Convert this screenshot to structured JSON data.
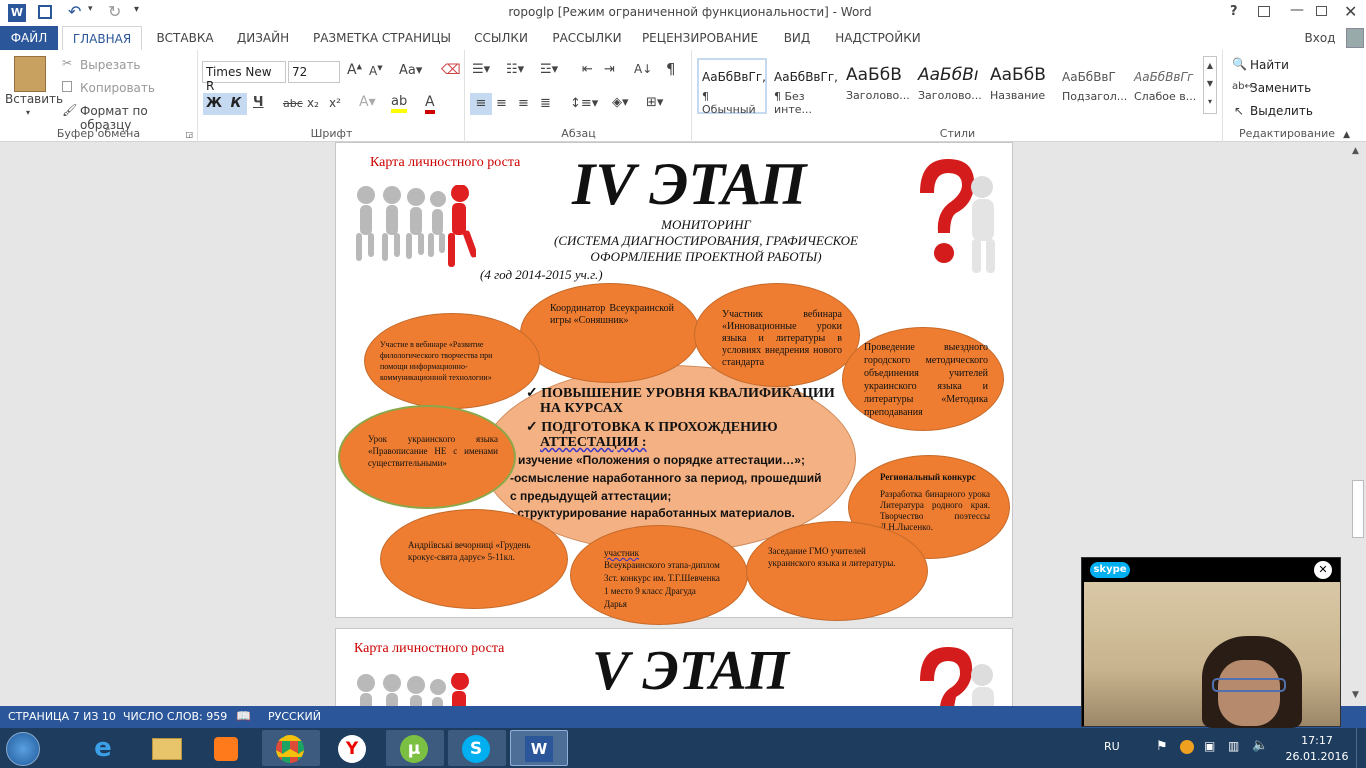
{
  "window": {
    "title": "ropoglp [Режим ограниченной функциональности] - Word",
    "help": "?",
    "login": "Вход"
  },
  "tabs": [
    "ФАЙЛ",
    "ГЛАВНАЯ",
    "ВСТАВКА",
    "ДИЗАЙН",
    "РАЗМЕТКА СТРАНИЦЫ",
    "ССЫЛКИ",
    "РАССЫЛКИ",
    "РЕЦЕНЗИРОВАНИЕ",
    "ВИД",
    "НАДСТРОЙКИ"
  ],
  "clipboard": {
    "paste": "Вставить",
    "cut": "Вырезать",
    "copy": "Копировать",
    "format": "Формат по образцу",
    "label": "Буфер обмена"
  },
  "font": {
    "name": "Times New R",
    "size": "72",
    "label": "Шрифт",
    "bold": "Ж",
    "italic": "К",
    "underline": "Ч",
    "strike": "abc",
    "sub": "x₂",
    "sup": "x²"
  },
  "paragraph": {
    "label": "Абзац"
  },
  "styles": {
    "label": "Стили",
    "items": [
      {
        "sample": "АаБбВвГг,",
        "name": "¶ Обычный"
      },
      {
        "sample": "АаБбВвГг,",
        "name": "¶ Без инте..."
      },
      {
        "sample": "АаБбВ",
        "name": "Заголово..."
      },
      {
        "sample": "АаБбВı",
        "name": "Заголово..."
      },
      {
        "sample": "АаБбВ",
        "name": "Название"
      },
      {
        "sample": "АаБбВвГ",
        "name": "Подзагол..."
      },
      {
        "sample": "АаБбВвГг",
        "name": "Слабое в..."
      }
    ]
  },
  "editing": {
    "find": "Найти",
    "replace": "Заменить",
    "select": "Выделить",
    "label": "Редактирование"
  },
  "page1": {
    "card": "Карта личностного роста",
    "stage": "IV ЭТАП",
    "sub1": "МОНИТОРИНГ",
    "sub2": "(СИСТЕМА ДИАГНОСТИРОВАНИЯ, ГРАФИЧЕСКОЕ",
    "sub3": "ОФОРМЛЕНИЕ ПРОЕКТНОЙ РАБОТЫ)",
    "year": "(4 год 2014-2015 уч.г.)",
    "center1": "ПОВЫШЕНИЕ УРОВНЯ КВАЛИФИКАЦИИ",
    "center2": "НА КУРСАХ",
    "center3": "ПОДГОТОВКА К ПРОХОЖДЕНИЮ",
    "center4": "АТТЕСТАЦИИ :",
    "center5": "изучение «Положения о порядке аттестации…»;",
    "center6": "-осмысление наработанного за период, прошедший",
    "center7": "с предыдущей аттестации;",
    "center8": "- структурирование наработанных материалов.",
    "e1": "Координатор Всеукраинской игры «Соняшник»",
    "e2": "Участник вебинара «Инновационные уроки языка и литературы в условиях внедрения нового стандарта",
    "e3": "Участие в вебинаре «Развитие филологического творчества при помощи информационно-коммуникационной технологии»",
    "e4": "Проведение выездного городского методического объединения учителей украинского языка и литературы «Методика преподавания",
    "e5": "Урок украинского языка «Правописание НЕ с именами существительными»",
    "e6": "Региональный конкурс",
    "e6b": "Разработка бинарного урока Литература родного края. Творчество поэтессы Л.Н.Лысенко.",
    "e7": "Андріївські вечорниці «Грудень крокує-свята дарує» 5-11кл.",
    "e8a": "участник",
    "e8b": "Всеукраинского этапа-диплом 3ст. конкурс им. Т.Г.Шевченка 1 место 9 класс Драгуда Дарья",
    "e9": "Заседание ГМО учителей украинского языка и литературы."
  },
  "page2": {
    "card": "Карта личностного роста",
    "stage": "V ЭТАП"
  },
  "status": {
    "page": "СТРАНИЦА 7 ИЗ 10",
    "words": "ЧИСЛО СЛОВ: 959",
    "lang": "РУССКИЙ"
  },
  "skype": {
    "logo": "skype"
  },
  "tray": {
    "lang": "RU",
    "time": "17:17",
    "date": "26.01.2016"
  }
}
